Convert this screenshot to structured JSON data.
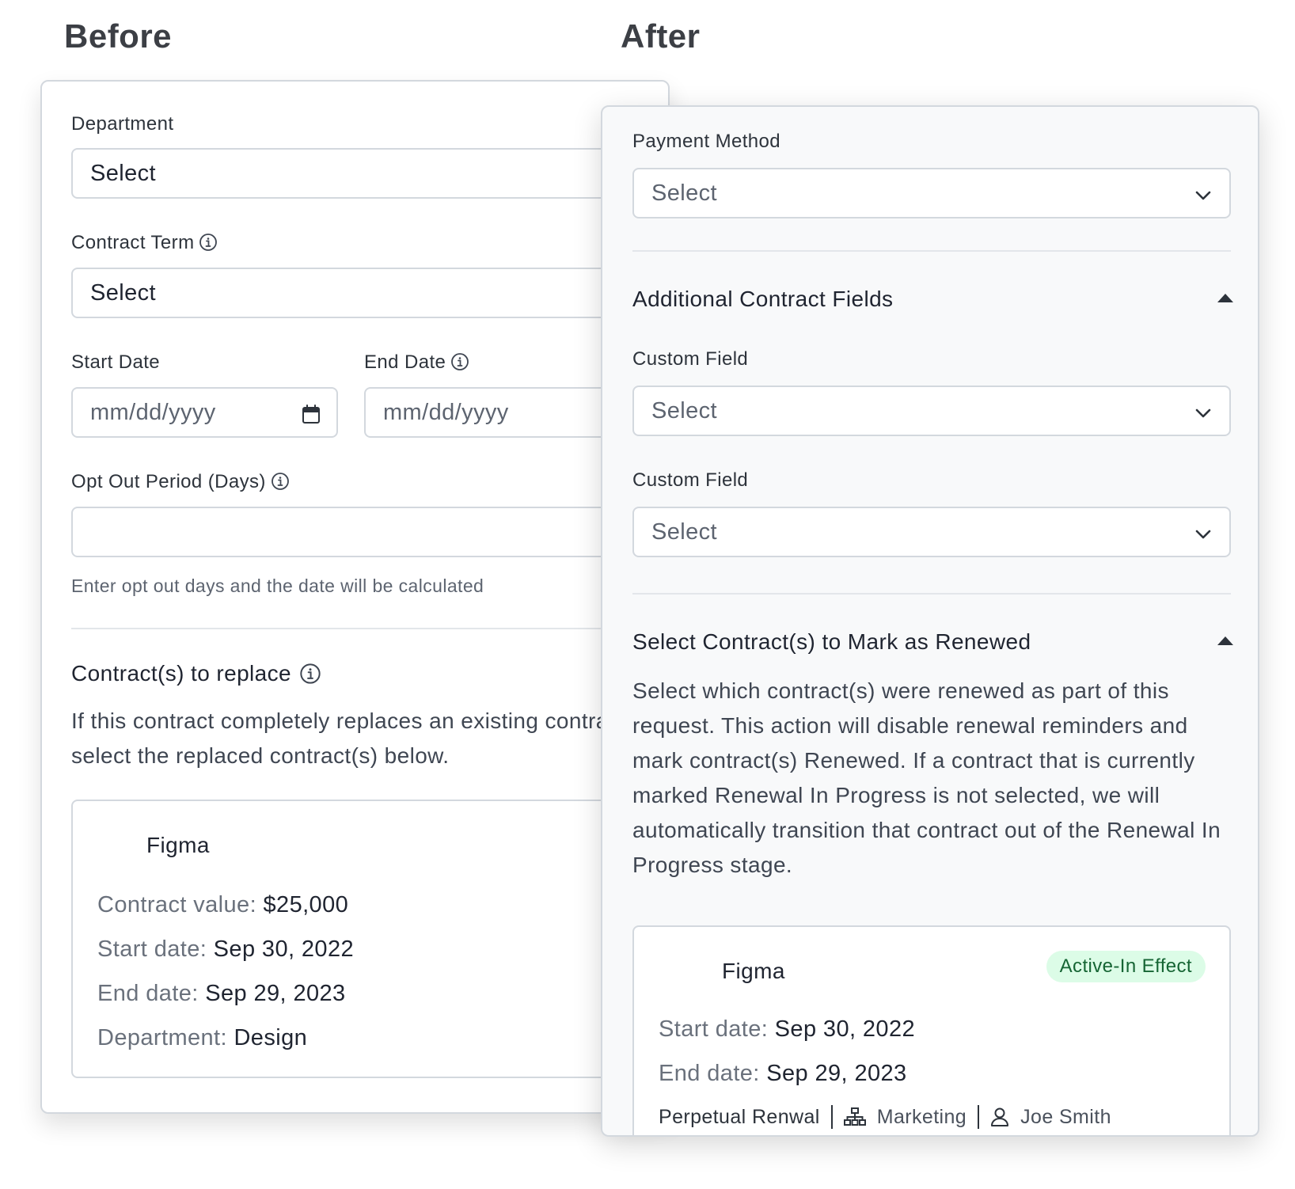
{
  "headings": {
    "before": "Before",
    "after": "After"
  },
  "before": {
    "department": {
      "label": "Department",
      "value": "Select"
    },
    "contract_term": {
      "label": "Contract Term",
      "value": "Select"
    },
    "start_date": {
      "label": "Start Date",
      "placeholder": "mm/dd/yyyy"
    },
    "end_date": {
      "label": "End Date",
      "placeholder": "mm/dd/yyyy"
    },
    "opt_out": {
      "label": "Opt Out Period (Days)",
      "value": "",
      "help": "Enter opt out days and the date will be calculated"
    },
    "replace": {
      "title": "Contract(s) to replace",
      "description": "If this contract completely replaces an existing contract(s), select the replaced contract(s) below."
    },
    "card": {
      "name": "Figma",
      "rows": [
        {
          "key": "Contract value:",
          "value": "$25,000"
        },
        {
          "key": "Start date:",
          "value": "Sep 30, 2022"
        },
        {
          "key": "End date:",
          "value": "Sep 29, 2023"
        },
        {
          "key": "Department:",
          "value": "Design"
        }
      ]
    }
  },
  "after": {
    "payment_method": {
      "label": "Payment Method",
      "value": "Select"
    },
    "additional": {
      "title": "Additional Contract Fields",
      "fields": [
        {
          "label": "Custom Field",
          "value": "Select"
        },
        {
          "label": "Custom Field",
          "value": "Select"
        }
      ]
    },
    "renewed": {
      "title": "Select Contract(s) to Mark as Renewed",
      "description": "Select which contract(s) were renewed as part of this request. This action will disable renewal reminders and mark contract(s) Renewed. If a contract that is currently marked Renewal In Progress is not selected, we will automatically transition that contract out of the Renewal In Progress stage."
    },
    "card": {
      "name": "Figma",
      "badge": "Active-In Effect",
      "rows": [
        {
          "key": "Start date:",
          "value": "Sep 30, 2022"
        },
        {
          "key": "End date:",
          "value": "Sep 29, 2023"
        }
      ],
      "renewal": "Perpetual Renwal",
      "department": "Marketing",
      "owner": "Joe Smith"
    }
  },
  "colors": {
    "badge_bg": "#dcfce7",
    "badge_text": "#166534",
    "border": "#d3d8de"
  },
  "icons": [
    "info-icon",
    "calendar-icon",
    "chevron-down-icon",
    "caret-up-icon",
    "org-chart-icon",
    "user-icon"
  ]
}
